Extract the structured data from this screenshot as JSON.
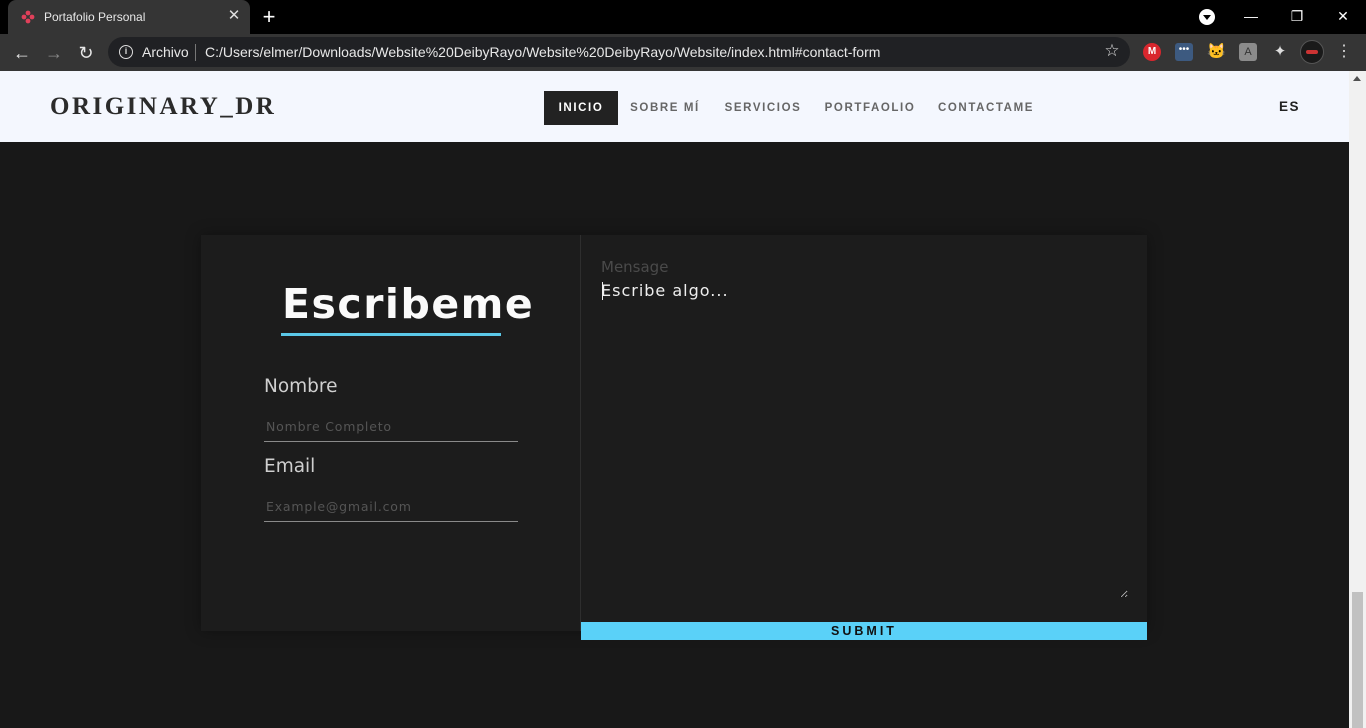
{
  "browser": {
    "tab_title": "Portafolio Personal",
    "tab_close": "✕",
    "new_tab": "+",
    "site_chip": "Archivo",
    "url": "C:/Users/elmer/Downloads/Website%20DeibyRayo/Website%20DeibyRayo/Website/index.html#contact-form",
    "window_controls": {
      "minimize": "—",
      "restore": "❐",
      "close": "✕"
    },
    "nav": {
      "back": "←",
      "forward": "→",
      "reload": "↻"
    },
    "extensions": {
      "mega": "M",
      "dots": "•••",
      "cat": "🐱",
      "pdf": "A",
      "puzzle": "✦"
    },
    "star": "☆",
    "menu": "⋮"
  },
  "header": {
    "brand": "ORIGINARY_DR",
    "nav": [
      {
        "label": "INICIO",
        "active": true
      },
      {
        "label": "SOBRE MÍ",
        "active": false
      },
      {
        "label": "SERVICIOS",
        "active": false
      },
      {
        "label": "PORTFAOLIO",
        "active": false
      },
      {
        "label": "CONTACTAME",
        "active": false
      }
    ],
    "language": "ES"
  },
  "contact_form": {
    "title": "Escribeme",
    "name_label": "Nombre",
    "name_placeholder": "Nombre Completo",
    "name_value": "",
    "email_label": "Email",
    "email_placeholder": "Example@gmail.com",
    "email_value": "",
    "message_label": "Mensage",
    "message_placeholder": "Escribe algo...",
    "message_value": "",
    "submit_label": "SUBMIT"
  },
  "colors": {
    "accent": "#5bc8e8",
    "submit": "#5ad1f8",
    "page_background": "#181818",
    "card_background": "#1c1c1c",
    "header_background": "#f4f7fe"
  }
}
